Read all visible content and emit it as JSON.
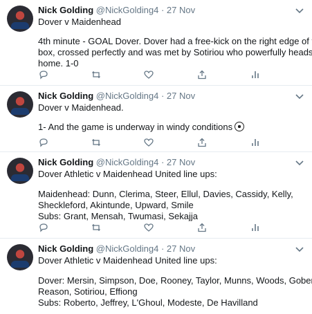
{
  "tweets": [
    {
      "name": "Nick Golding",
      "handle": "@NickGolding4",
      "separator": "·",
      "date": "27 Nov",
      "lines": [
        "Dover v Maidenhead",
        "",
        "4th minute - GOAL Dover. Dover had a free-kick on the right edge of the",
        "box, crossed perfectly and was met by Sotiriou who powerfully heads it",
        "home. 1-0"
      ]
    },
    {
      "name": "Nick Golding",
      "handle": "@NickGolding4",
      "separator": "·",
      "date": "27 Nov",
      "lines": [
        "Dover v Maidenhead.",
        "",
        "1- And the game is underway in windy conditions"
      ]
    },
    {
      "name": "Nick Golding",
      "handle": "@NickGolding4",
      "separator": "·",
      "date": "27 Nov",
      "lines": [
        "Dover Athletic v Maidenhead United line ups:",
        "",
        "Maidenhead: Dunn, Clerima, Steer, Ellul, Davies, Cassidy, Kelly,",
        "Sheckleford, Akintunde, Upward, Smile",
        "Subs: Grant, Mensah, Twumasi, Sekajja"
      ]
    },
    {
      "name": "Nick Golding",
      "handle": "@NickGolding4",
      "separator": "·",
      "date": "27 Nov",
      "lines": [
        "Dover Athletic v Maidenhead United line ups:",
        "",
        "Dover: Mersin, Simpson, Doe, Rooney, Taylor, Munns, Woods, Gobern,",
        "Reason, Sotiriou, Effiong",
        "Subs: Roberto, Jeffrey, L'Ghoul, Modeste, De Havilland"
      ]
    }
  ],
  "icons": {
    "reply": "reply-icon",
    "retweet": "retweet-icon",
    "like": "heart-icon",
    "share": "share-icon",
    "analytics": "analytics-icon",
    "caret": "chevron-down-icon",
    "emoji": "soccer-ball-icon"
  },
  "colors": {
    "icon": "#657786",
    "text": "#14171a",
    "secondary": "#657786",
    "divider": "#e6ecf0"
  }
}
